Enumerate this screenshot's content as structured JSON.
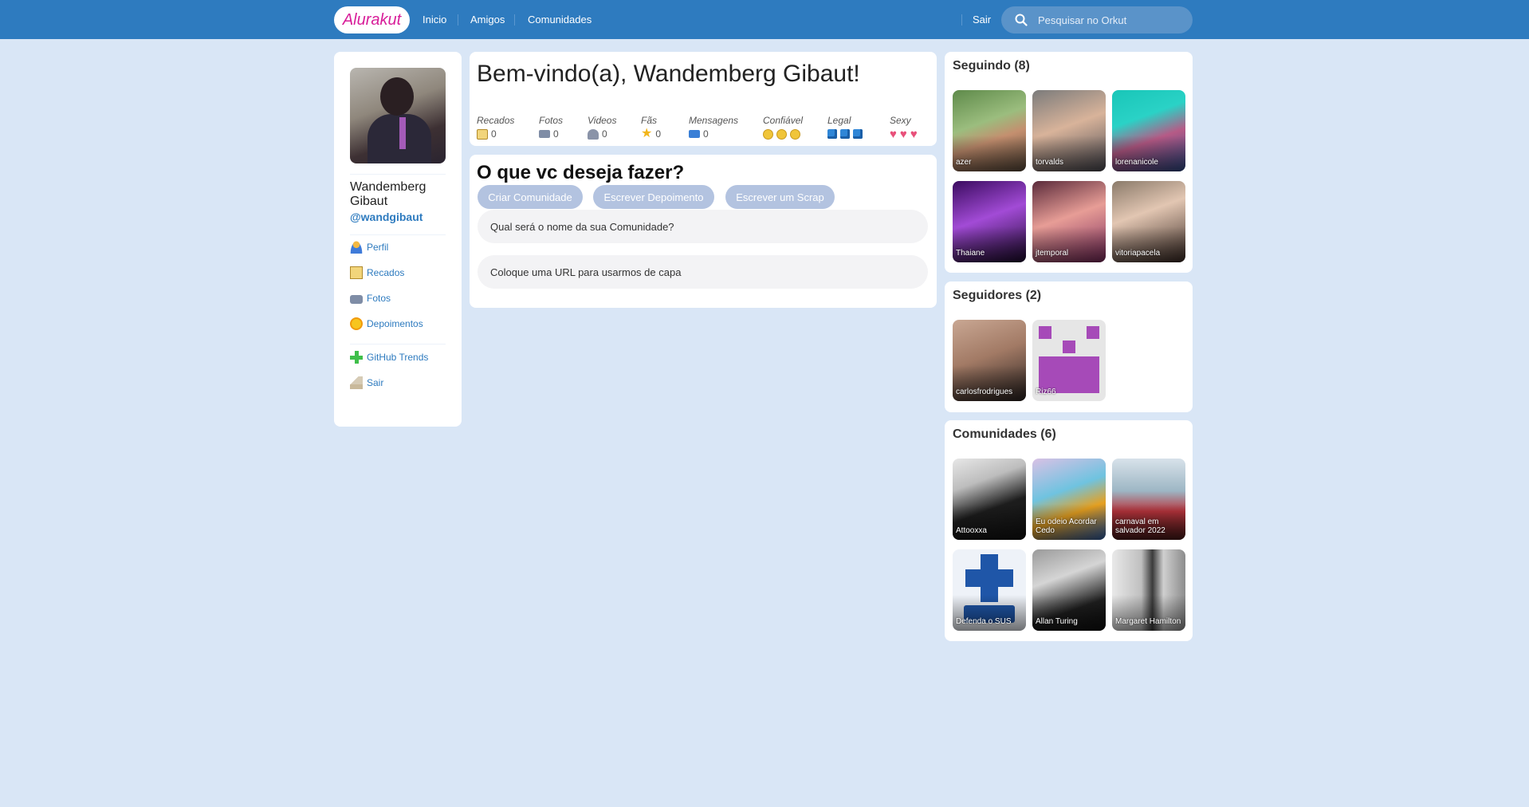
{
  "header": {
    "logo": "Alurakut",
    "nav": [
      "Inicio",
      "Amigos",
      "Comunidades"
    ],
    "logout": "Sair",
    "search_placeholder": "Pesquisar no Orkut"
  },
  "profile": {
    "name": "Wandemberg Gibaut",
    "username": "@wandgibaut",
    "menu": [
      "Perfil",
      "Recados",
      "Fotos",
      "Depoimentos"
    ],
    "menu2": [
      "GitHub Trends",
      "Sair"
    ]
  },
  "welcome": {
    "title": "Bem-vindo(a), Wandemberg Gibaut!",
    "stats": [
      {
        "label": "Recados",
        "value": "0",
        "icon": "notebook-icon"
      },
      {
        "label": "Fotos",
        "value": "0",
        "icon": "camera-icon"
      },
      {
        "label": "Videos",
        "value": "0",
        "icon": "video-camera-icon"
      },
      {
        "label": "Fãs",
        "value": "0",
        "icon": "star-icon"
      },
      {
        "label": "Mensagens",
        "value": "0",
        "icon": "envelope-icon"
      }
    ],
    "ratings": [
      {
        "label": "Confiável",
        "icon": "smiley-icon",
        "count": 3
      },
      {
        "label": "Legal",
        "icon": "ice-cube-icon",
        "count": 3
      },
      {
        "label": "Sexy",
        "icon": "heart-icon",
        "count": 3
      }
    ]
  },
  "actions": {
    "title": "O que vc deseja fazer?",
    "buttons": [
      "Criar Comunidade",
      "Escrever Depoimento",
      "Escrever um Scrap"
    ],
    "community_name_placeholder": "Qual será o nome da sua Comunidade?",
    "cover_url_placeholder": "Coloque uma URL para usarmos de capa"
  },
  "following": {
    "title": "Seguindo (8)",
    "items": [
      "azer",
      "torvalds",
      "lorenanicole",
      "Thaiane",
      "jtemporal",
      "vitoriapacela"
    ]
  },
  "followers": {
    "title": "Seguidores (2)",
    "items": [
      "carlosfrodrigues",
      "Riz66"
    ]
  },
  "communities": {
    "title": "Comunidades (6)",
    "items": [
      "Attooxxa",
      "Eu odeio Acordar Cedo",
      "carnaval em salvador 2022",
      "Defenda o SUS",
      "Allan Turing",
      "Margaret Hamilton"
    ]
  },
  "colors": {
    "header": "#2e7bbf",
    "background": "#d9e6f6",
    "link": "#2e7bbf",
    "logo": "#d81d99",
    "pill": "#b3c3e0"
  }
}
